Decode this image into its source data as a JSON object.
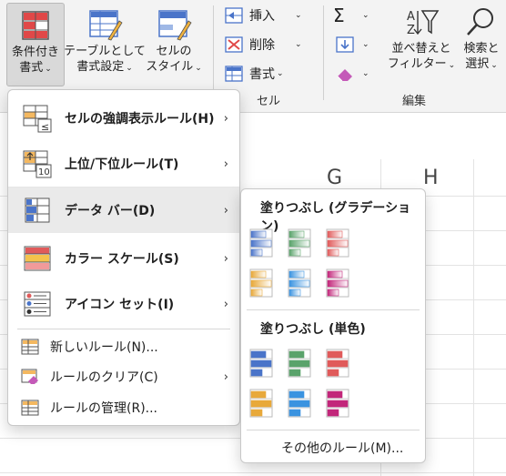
{
  "ribbon": {
    "conditional_format": {
      "line1": "条件付き",
      "line2": "書式"
    },
    "format_table": {
      "line1": "テーブルとして",
      "line2": "書式設定"
    },
    "cell_styles": {
      "line1": "セルの",
      "line2": "スタイル"
    },
    "insert": "挿入",
    "delete": "削除",
    "format": "書式",
    "cells_group": "セル",
    "sort_filter": {
      "line1": "並べ替えと",
      "line2": "フィルター"
    },
    "find_select": {
      "line1": "検索と",
      "line2": "選択"
    },
    "editing_group": "編集"
  },
  "columns": [
    "G",
    "H"
  ],
  "menu": {
    "items": [
      {
        "label": "セルの強調表示ルール(H)",
        "icon": "highlight-cells-icon"
      },
      {
        "label": "上位/下位ルール(T)",
        "icon": "top-bottom-icon"
      },
      {
        "label": "データ バー(D)",
        "icon": "data-bars-icon"
      },
      {
        "label": "カラー スケール(S)",
        "icon": "color-scales-icon"
      },
      {
        "label": "アイコン セット(I)",
        "icon": "icon-sets-icon"
      }
    ],
    "new_rule": "新しいルール(N)...",
    "clear_rules": "ルールのクリア(C)",
    "manage_rules": "ルールの管理(R)..."
  },
  "submenu": {
    "gradient_heading": "塗りつぶし (グラデーション)",
    "solid_heading": "塗りつぶし (単色)",
    "more_rules": "その他のルール(M)...",
    "bar_colors": [
      "#4a74c9",
      "#5aa36b",
      "#e05a5a",
      "#e8a93a",
      "#3a93e0",
      "#c2267a"
    ]
  }
}
